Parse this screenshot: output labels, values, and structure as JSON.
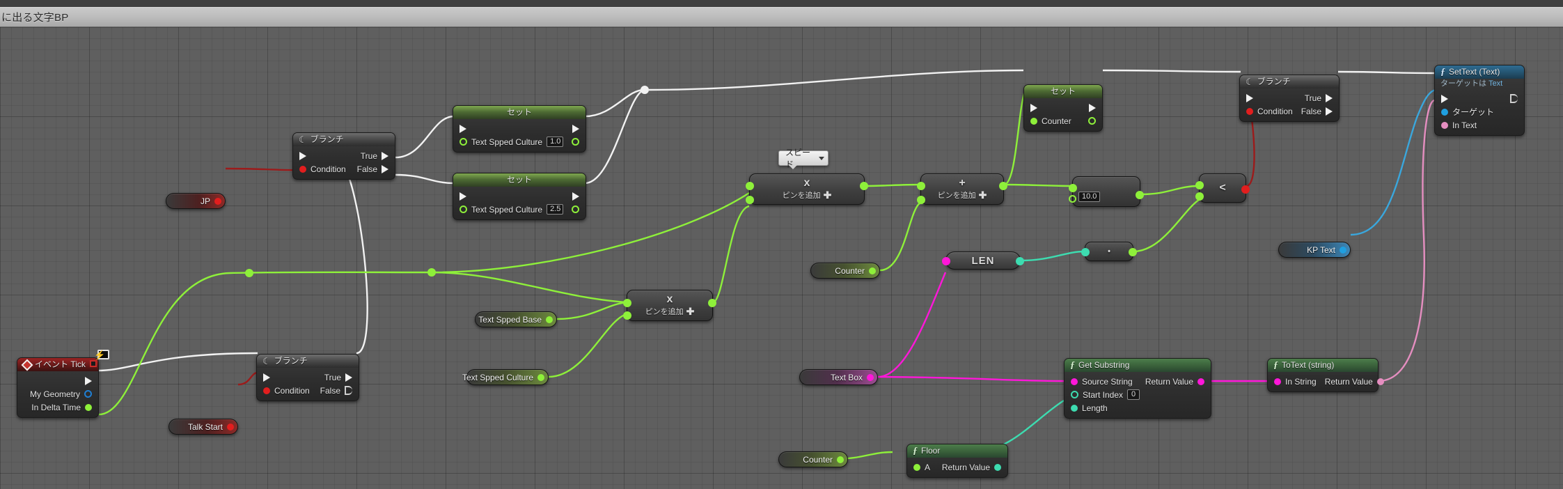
{
  "window": {
    "title": "に出る文字BP"
  },
  "graph": {
    "nodes": {
      "event_tick": {
        "title": "イベント Tick",
        "pins": {
          "exec_out": "",
          "my_geometry": "My Geometry",
          "in_delta_time": "In Delta Time"
        }
      },
      "branch_jp": {
        "title": "ブランチ",
        "pins": {
          "condition": "Condition",
          "true": "True",
          "false": "False"
        }
      },
      "branch_talk": {
        "title": "ブランチ",
        "pins": {
          "condition": "Condition",
          "true": "True",
          "false": "False"
        }
      },
      "branch_right": {
        "title": "ブランチ",
        "pins": {
          "condition": "Condition",
          "true": "True",
          "false": "False"
        }
      },
      "set_culture_1": {
        "title": "セット",
        "pin_label": "Text Spped Culture",
        "value": "1.0"
      },
      "set_culture_2": {
        "title": "セット",
        "pin_label": "Text Spped Culture",
        "value": "2.5"
      },
      "set_counter": {
        "title": "セット",
        "pin_label": "Counter"
      },
      "set_text": {
        "title": "SetText (Text)",
        "subtitle_prefix": "ターゲットは ",
        "subtitle_target": "Text",
        "pins": {
          "target": "ターゲット",
          "in_text": "In Text"
        }
      },
      "get_substring": {
        "title": "Get Substring",
        "pins": {
          "source_string": "Source String",
          "start_index": "Start Index",
          "length": "Length",
          "return_value": "Return Value"
        },
        "start_index_value": "0"
      },
      "to_text": {
        "title": "ToText (string)",
        "pins": {
          "in_string": "In String",
          "return_value": "Return Value"
        }
      },
      "floor": {
        "title": "Floor",
        "pins": {
          "a": "A",
          "return_value": "Return Value"
        }
      },
      "multiply_base": {
        "symbol": "x",
        "addpin": "ピンを追加"
      },
      "multiply_speed": {
        "symbol": "x",
        "addpin": "ピンを追加"
      },
      "add_counter": {
        "symbol": "+",
        "addpin": "ピンを追加"
      },
      "divide_ten": {
        "symbol": "",
        "value": "10.0"
      },
      "less_than": {
        "symbol": "<"
      },
      "multiply_len": {
        "symbol": ""
      },
      "len": {
        "label": "LEN"
      }
    },
    "variables": {
      "jp": "JP",
      "talk_start": "Talk Start",
      "text_spped_base": "Text Spped Base",
      "text_spped_culture": "Text Spped Culture",
      "counter_mid": "Counter",
      "counter_bottom": "Counter",
      "text_box": "Text Box",
      "kp_text": "KP Text"
    },
    "tooltip": {
      "speed": "スピード"
    }
  },
  "colors": {
    "exec": "#f2f2f2",
    "float": "#8ef03a",
    "int": "#3ddcb0",
    "string": "#ff17d9",
    "text": "#e58ec0",
    "bool": "#e21e1e",
    "object": "#1f7fd4",
    "canvas": "#5f5f5f",
    "titlebar": "#bcbcbc"
  }
}
